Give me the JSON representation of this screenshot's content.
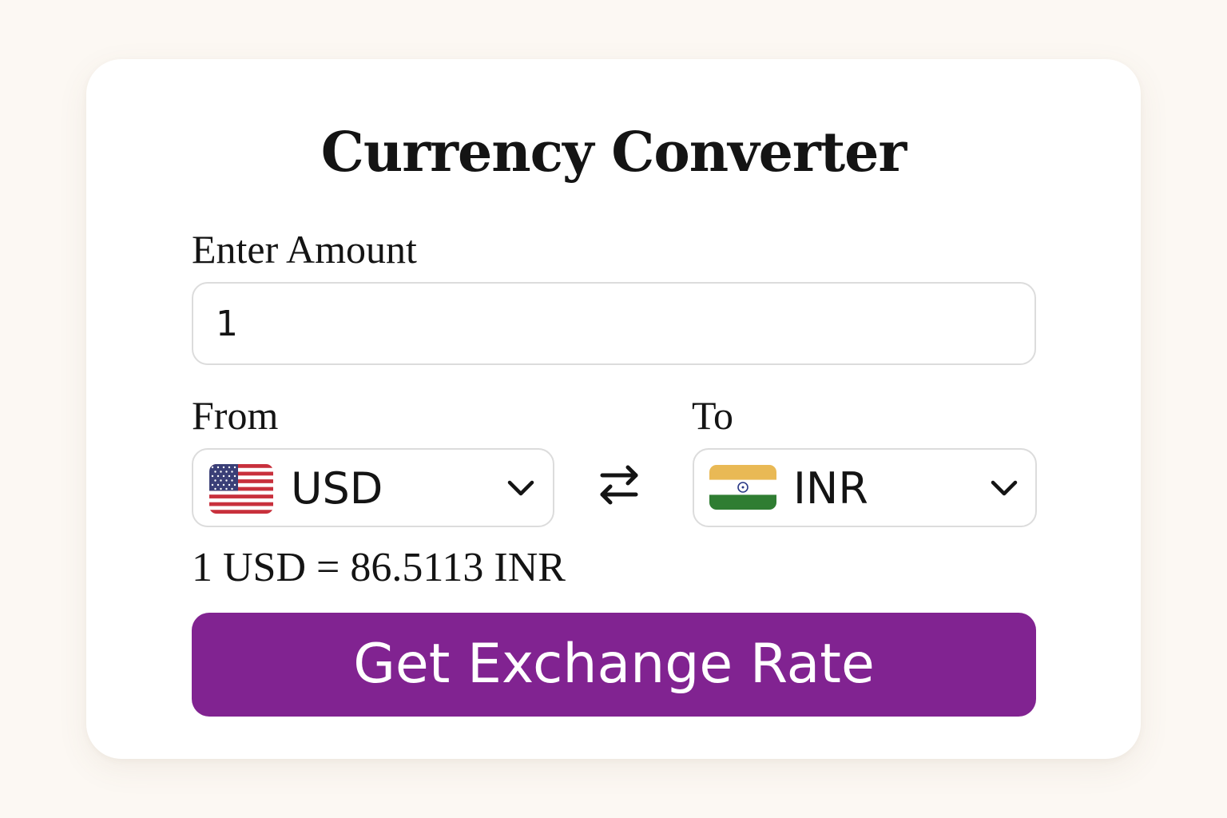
{
  "title": "Currency Converter",
  "amount": {
    "label": "Enter Amount",
    "value": "1"
  },
  "from": {
    "label": "From",
    "currency": "USD",
    "flag_icon": "us-flag-icon"
  },
  "to": {
    "label": "To",
    "currency": "INR",
    "flag_icon": "india-flag-icon"
  },
  "swap_icon": "swap-arrows-icon",
  "result": "1 USD = 86.5113 INR",
  "button_label": "Get Exchange Rate",
  "colors": {
    "background": "#fcf8f3",
    "card": "#ffffff",
    "accent": "#812391",
    "border": "#dcdcdc",
    "text": "#141414"
  }
}
